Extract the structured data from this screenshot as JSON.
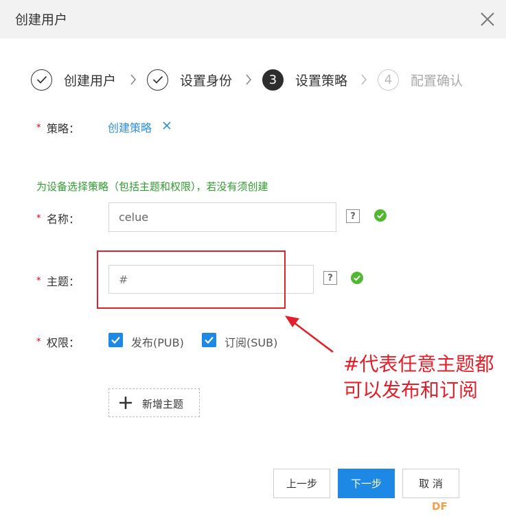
{
  "dialog": {
    "title": "创建用户"
  },
  "steps": [
    {
      "marker": "",
      "label": "创建用户",
      "state": "done"
    },
    {
      "marker": "",
      "label": "设置身份",
      "state": "done"
    },
    {
      "marker": "3",
      "label": "设置策略",
      "state": "active"
    },
    {
      "marker": "4",
      "label": "配置确认",
      "state": "pending"
    }
  ],
  "form": {
    "required_mark": "*",
    "policy": {
      "label": "策略：",
      "link_text": "创建策略"
    },
    "hint": "为设备选择策略（包括主题和权限），若没有须创建",
    "name": {
      "label": "名称：",
      "value": "celue"
    },
    "topic": {
      "label": "主题：",
      "value": "#"
    },
    "permission": {
      "label": "权限：",
      "options": [
        {
          "label": "发布(PUB)",
          "checked": true
        },
        {
          "label": "订阅(SUB)",
          "checked": true
        }
      ]
    },
    "help_glyph": "?",
    "add_topic_label": "新增主题"
  },
  "buttons": {
    "prev": "上一步",
    "next": "下一步",
    "cancel": "取 消"
  },
  "annotation": {
    "text": "#代表任意主题都可以发布和订阅"
  },
  "watermark": "DF",
  "colors": {
    "primary": "#1e88e5",
    "success": "#52b832",
    "hint": "#2e9e2e",
    "annotation": "#e0202a",
    "link": "#2e8fd6"
  }
}
